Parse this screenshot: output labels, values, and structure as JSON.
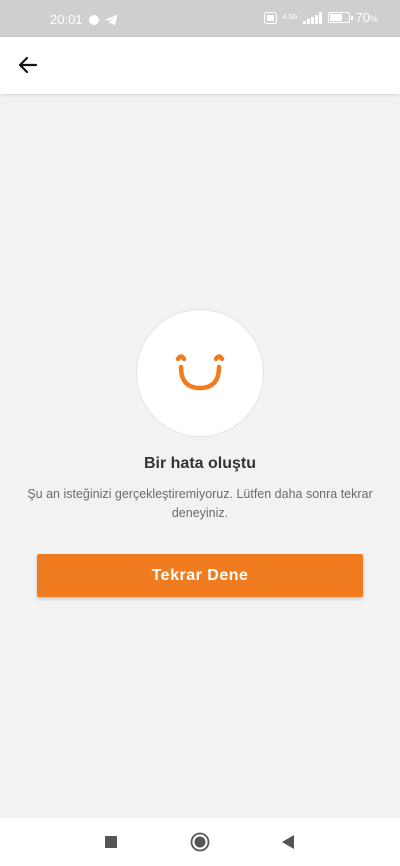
{
  "status_bar": {
    "time": "20:01",
    "network_label": "4.5G",
    "battery_level": 70,
    "battery_text": "70"
  },
  "app_bar": {
    "back_icon": "arrow-left-icon"
  },
  "error": {
    "icon": "smile-icon",
    "title": "Bir hata oluştu",
    "message": "Şu an isteğinizi gerçekleştiremiyoruz. Lütfen daha sonra tekrar deneyiniz."
  },
  "retry_button": {
    "label": "Tekrar Dene"
  },
  "nav_bar": {
    "items": [
      "recent-apps-icon",
      "home-icon",
      "back-triangle-icon"
    ]
  },
  "colors": {
    "accent": "#f07c1f",
    "background": "#f2f2f2",
    "status_bar": "#cfcfcf"
  }
}
